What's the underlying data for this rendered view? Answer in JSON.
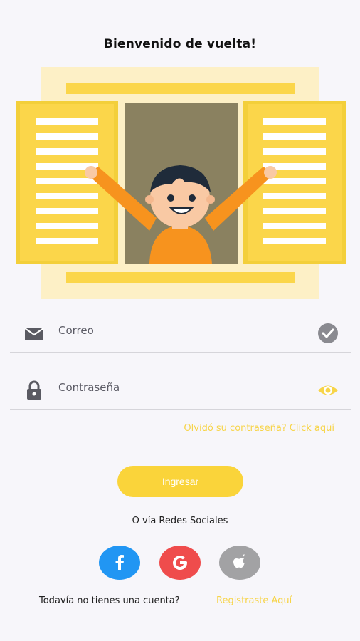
{
  "header": {
    "title": "Bienvenido de vuelta!"
  },
  "illustration": {
    "name": "window-waving-person-illustration"
  },
  "form": {
    "email": {
      "label": "Correo",
      "lead_icon": "mail-icon",
      "trail_icon": "check-circle-icon"
    },
    "password": {
      "label": "Contraseña",
      "lead_icon": "lock-icon",
      "trail_icon": "eye-icon"
    },
    "forgot": "Olvidó su contraseña? Click aquí",
    "submit": "Ingresar"
  },
  "social": {
    "label": "O vía Redes Sociales",
    "buttons": [
      {
        "name": "facebook",
        "color": "#2196f3"
      },
      {
        "name": "google",
        "color": "#ef4c4c"
      },
      {
        "name": "apple",
        "color": "#a2a2a4"
      }
    ]
  },
  "footer": {
    "prompt": "Todavía no tienes una cuenta?",
    "register": "Registraste Aquí"
  },
  "colors": {
    "accent": "#fad43a",
    "background": "#f7f6fa"
  }
}
